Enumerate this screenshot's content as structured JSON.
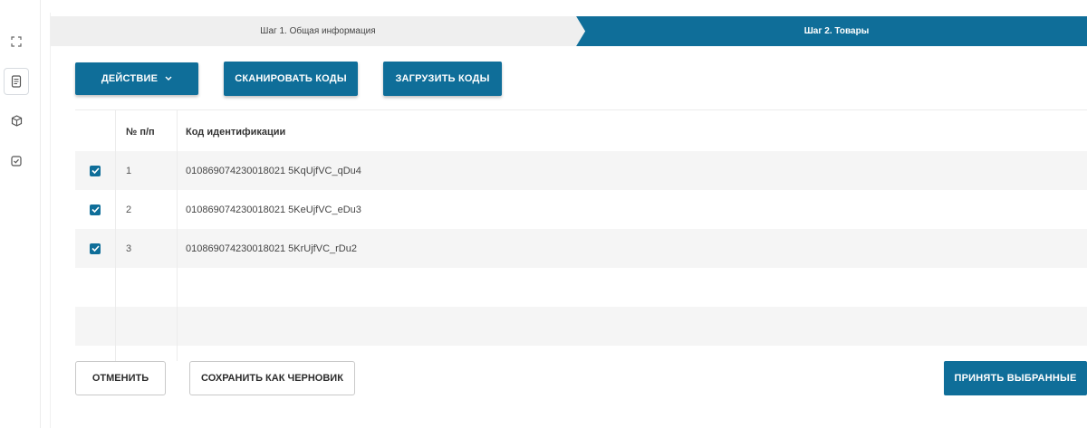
{
  "stepper": {
    "step1_label": "Шаг 1. Общая информация",
    "step2_label": "Шаг 2. Товары"
  },
  "toolbar": {
    "action_label": "ДЕЙСТВИЕ",
    "scan_label": "СКАНИРОВАТЬ КОДЫ",
    "upload_label": "ЗАГРУЗИТЬ КОДЫ"
  },
  "table": {
    "header": {
      "num": "№ п/п",
      "code": "Код идентификации"
    },
    "rows": [
      {
        "checked": true,
        "num": "1",
        "code": "010869074230018021 5KqUjfVC_qDu4"
      },
      {
        "checked": true,
        "num": "2",
        "code": "010869074230018021 5KeUjfVC_eDu3"
      },
      {
        "checked": true,
        "num": "3",
        "code": "010869074230018021 5KrUjfVC_rDu2"
      }
    ]
  },
  "footer": {
    "cancel_label": "ОТМЕНИТЬ",
    "draft_label": "СОХРАНИТЬ КАК ЧЕРНОВИК",
    "accept_label": "ПРИНЯТЬ ВЫБРАННЫЕ"
  },
  "colors": {
    "accent": "#0f6e99",
    "row_shade": "#f5f5f5",
    "step_inactive": "#efefef"
  },
  "icons": {
    "rail": [
      "expand-icon",
      "document-icon",
      "box-icon",
      "checklist-icon"
    ],
    "action_dropdown": "chevron-down-icon",
    "checkbox": "check-icon"
  }
}
